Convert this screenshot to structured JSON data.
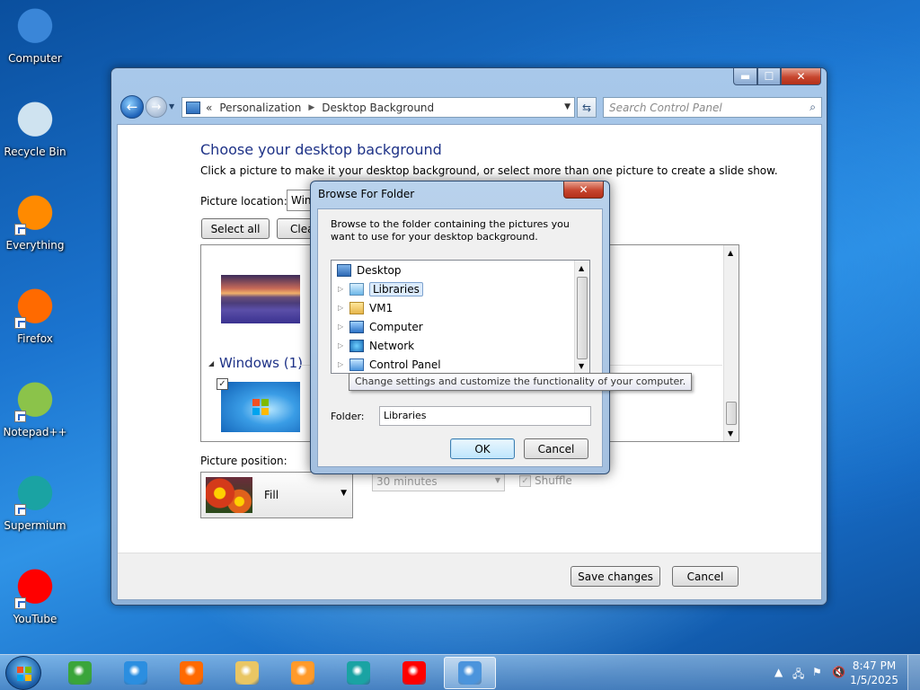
{
  "desktop": {
    "icons": [
      {
        "label": "Computer",
        "icon": "computer-icon",
        "color": "#3a86d8"
      },
      {
        "label": "Recycle Bin",
        "icon": "recycle-bin-icon",
        "color": "#cfe3f0"
      },
      {
        "label": "Everything",
        "icon": "everything-icon",
        "color": "#ff8a00"
      },
      {
        "label": "Firefox",
        "icon": "firefox-icon",
        "color": "#ff6a00"
      },
      {
        "label": "Notepad++",
        "icon": "notepadpp-icon",
        "color": "#8bc34a"
      },
      {
        "label": "Supermium",
        "icon": "supermium-icon",
        "color": "#1aa3a3"
      },
      {
        "label": "YouTube",
        "icon": "youtube-icon",
        "color": "#ff0000"
      }
    ]
  },
  "window": {
    "min_label": "▬",
    "max_label": "☐",
    "close_label": "✕",
    "breadcrumb": {
      "prefix": "«",
      "items": [
        "Personalization",
        "Desktop Background"
      ]
    },
    "search_placeholder": "Search Control Panel",
    "title": "Choose your desktop background",
    "subtitle": "Click a picture to make it your desktop background, or select more than one picture to create a slide show.",
    "picture_location_label": "Picture location:",
    "picture_location_value": "Win",
    "select_all": "Select all",
    "clear_all": "Clea",
    "group_name": "Windows (1)",
    "picture_position_label": "Picture position:",
    "picture_position_value": "Fill",
    "interval_value": "30 minutes",
    "shuffle_label": "Shuffle",
    "save_changes": "Save changes",
    "cancel": "Cancel"
  },
  "dialog": {
    "title": "Browse For Folder",
    "close_label": "✕",
    "description": "Browse to the folder containing the pictures you want to use for your desktop background.",
    "tree": [
      {
        "label": "Desktop",
        "icon": "desktop-icon",
        "expandable": false,
        "selected": false
      },
      {
        "label": "Libraries",
        "icon": "libraries-icon",
        "expandable": true,
        "selected": true
      },
      {
        "label": "VM1",
        "icon": "user-folder-icon",
        "expandable": true,
        "selected": false
      },
      {
        "label": "Computer",
        "icon": "computer-icon",
        "expandable": true,
        "selected": false
      },
      {
        "label": "Network",
        "icon": "network-icon",
        "expandable": true,
        "selected": false
      },
      {
        "label": "Control Panel",
        "icon": "control-panel-icon",
        "expandable": true,
        "selected": false
      }
    ],
    "tooltip": "Change settings and customize the functionality of your computer.",
    "folder_label": "Folder:",
    "folder_value": "Libraries",
    "ok": "OK",
    "cancel": "Cancel"
  },
  "taskbar": {
    "apps": [
      {
        "icon": "windows-media-center-icon",
        "color": "#3aa53a",
        "active": false
      },
      {
        "icon": "internet-explorer-icon",
        "color": "#2b8ee0",
        "active": false
      },
      {
        "icon": "firefox-icon",
        "color": "#ff6a00",
        "active": false
      },
      {
        "icon": "file-explorer-icon",
        "color": "#e9c664",
        "active": false
      },
      {
        "icon": "media-player-icon",
        "color": "#ff9a2a",
        "active": false
      },
      {
        "icon": "supermium-icon",
        "color": "#1aa3a3",
        "active": false
      },
      {
        "icon": "youtube-icon",
        "color": "#ff0000",
        "active": false
      },
      {
        "icon": "control-panel-icon",
        "color": "#4b94dc",
        "active": true
      }
    ],
    "time": "8:47 PM",
    "date": "1/5/2025"
  }
}
